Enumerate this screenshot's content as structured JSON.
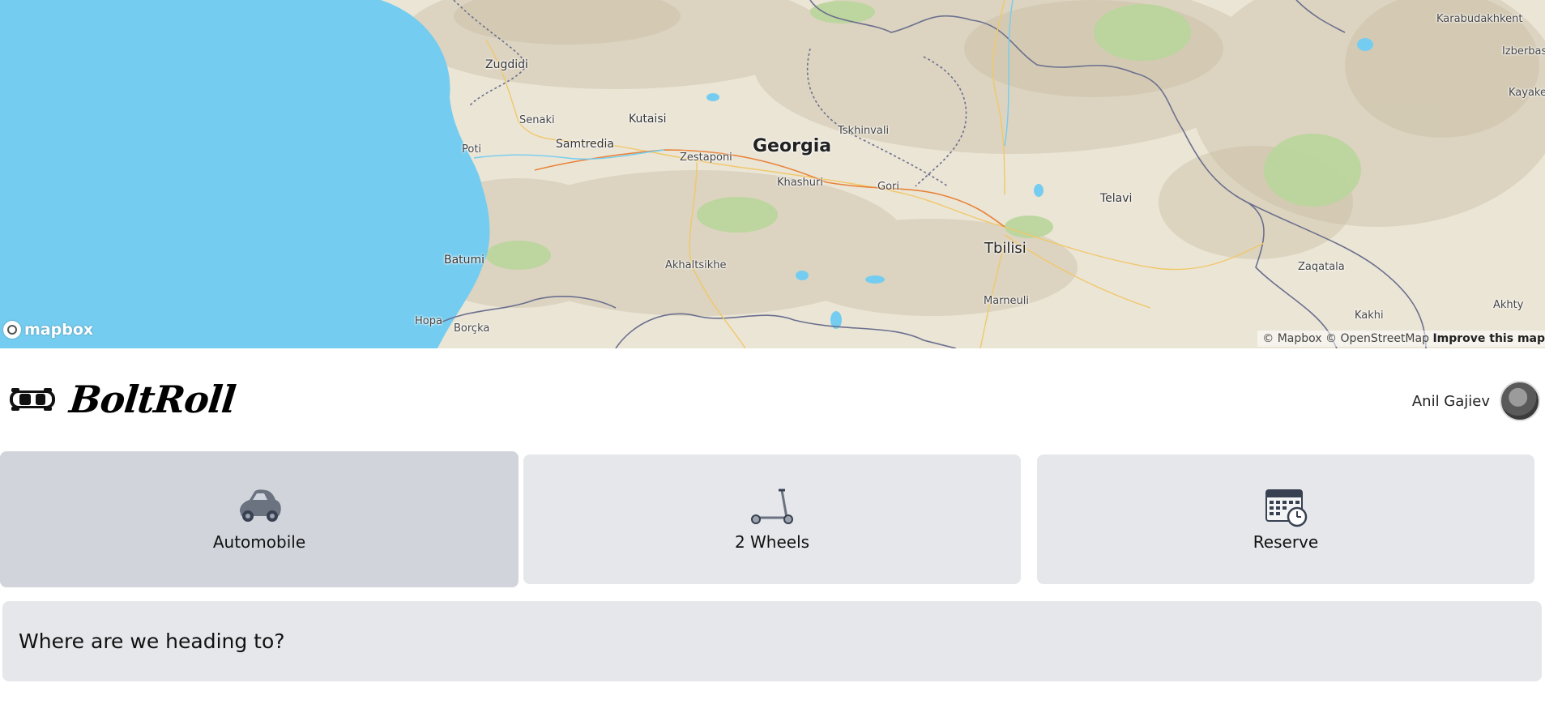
{
  "map": {
    "country_label": "Georgia",
    "cities": [
      {
        "name": "Zugdidi"
      },
      {
        "name": "Senaki"
      },
      {
        "name": "Kutaisi"
      },
      {
        "name": "Samtredia"
      },
      {
        "name": "Poti"
      },
      {
        "name": "Zestaponi"
      },
      {
        "name": "Tskhinvali"
      },
      {
        "name": "Khashuri"
      },
      {
        "name": "Gori"
      },
      {
        "name": "Telavi"
      },
      {
        "name": "Tbilisi"
      },
      {
        "name": "Batumi"
      },
      {
        "name": "Akhaltsikhe"
      },
      {
        "name": "Marneuli"
      },
      {
        "name": "Hopa"
      },
      {
        "name": "Borçka"
      },
      {
        "name": "Zaqatala"
      },
      {
        "name": "Kakhi"
      },
      {
        "name": "Akhty"
      },
      {
        "name": "Karabudakhkent"
      },
      {
        "name": "Izberbas"
      },
      {
        "name": "Kayake"
      }
    ],
    "logo_text": "mapbox",
    "attribution": {
      "mapbox": "© Mapbox",
      "osm": "© OpenStreetMap",
      "improve": "Improve this map"
    },
    "colors": {
      "water": "#74cdf0",
      "land": "#e9e3d3",
      "forest": "#b9d59a",
      "border": "#6b6f8e",
      "road": "#e8833a"
    }
  },
  "header": {
    "brand_name": "BoltRoll",
    "logo_icon": "car-top-view-icon",
    "user_name": "Anil Gajiev",
    "avatar_icon": "user-avatar"
  },
  "options": [
    {
      "label": "Automobile",
      "icon": "car-icon",
      "selected": true
    },
    {
      "label": "2 Wheels",
      "icon": "scooter-icon",
      "selected": false
    },
    {
      "label": "Reserve",
      "icon": "calendar-clock-icon",
      "selected": false
    }
  ],
  "destination": {
    "prompt": "Where are we heading to?"
  },
  "colors": {
    "option_bg": "#e5e7eb",
    "option_selected_bg": "#d1d5db"
  }
}
